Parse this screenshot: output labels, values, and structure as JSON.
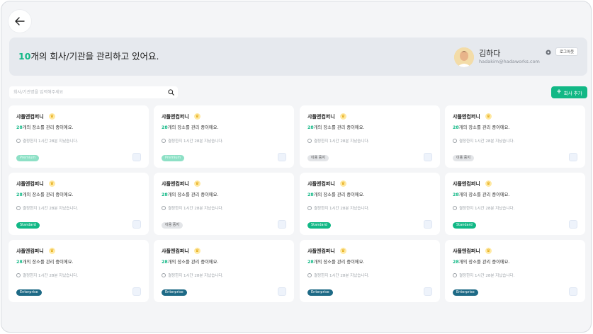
{
  "header": {
    "count": "10",
    "title_rest": "개의 회사/기관을 관리하고 있어요.",
    "user_name": "김하다",
    "user_email": "hadakim@hadaworks.com",
    "logout_label": "로그아웃"
  },
  "search": {
    "placeholder": "회사/기관명을 입력해주세요"
  },
  "add_button_label": "회사 추가",
  "accent_color": "#12b886",
  "cards": [
    {
      "name": "샤플엔컴퍼니",
      "count": "28",
      "desc": "개의 장소를 관리 중이에요.",
      "time": "결정한지 1시간 28분 지났습니다.",
      "badge": "Premium",
      "badge_type": "premium"
    },
    {
      "name": "샤플엔컴퍼니",
      "count": "28",
      "desc": "개의 장소를 관리 중이에요.",
      "time": "결정한지 1시간 28분 지났습니다.",
      "badge": "Premium",
      "badge_type": "premium"
    },
    {
      "name": "샤플엔컴퍼니",
      "count": "28",
      "desc": "개의 장소를 관리 중이에요.",
      "time": "결정한지 1시간 28분 지났습니다.",
      "badge": "이용 중지",
      "badge_type": "notused"
    },
    {
      "name": "샤플엔컴퍼니",
      "count": "28",
      "desc": "개의 장소를 관리 중이에요.",
      "time": "결정한지 1시간 28분 지났습니다.",
      "badge": "이용 중지",
      "badge_type": "notused"
    },
    {
      "name": "샤플엔컴퍼니",
      "count": "28",
      "desc": "개의 장소를 관리 중이에요.",
      "time": "결정한지 1시간 28분 지났습니다.",
      "badge": "Standard",
      "badge_type": "standard"
    },
    {
      "name": "샤플엔컴퍼니",
      "count": "28",
      "desc": "개의 장소를 관리 중이에요.",
      "time": "결정한지 1시간 28분 지났습니다.",
      "badge": "이용 중지",
      "badge_type": "notused"
    },
    {
      "name": "샤플엔컴퍼니",
      "count": "28",
      "desc": "개의 장소를 관리 중이에요.",
      "time": "결정한지 1시간 28분 지났습니다.",
      "badge": "Standard",
      "badge_type": "standard"
    },
    {
      "name": "샤플엔컴퍼니",
      "count": "28",
      "desc": "개의 장소를 관리 중이에요.",
      "time": "결정한지 1시간 28분 지났습니다.",
      "badge": "Standard",
      "badge_type": "standard"
    },
    {
      "name": "샤플엔컴퍼니",
      "count": "28",
      "desc": "개의 장소를 관리 중이에요.",
      "time": "결정한지 1시간 28분 지났습니다.",
      "badge": "Enterprise",
      "badge_type": "enterprise"
    },
    {
      "name": "샤플엔컴퍼니",
      "count": "28",
      "desc": "개의 장소를 관리 중이에요.",
      "time": "결정한지 1시간 28분 지났습니다.",
      "badge": "Enterprise",
      "badge_type": "enterprise"
    },
    {
      "name": "샤플엔컴퍼니",
      "count": "28",
      "desc": "개의 장소를 관리 중이에요.",
      "time": "결정한지 1시간 28분 지났습니다.",
      "badge": "Enterprise",
      "badge_type": "enterprise"
    },
    {
      "name": "샤플엔컴퍼니",
      "count": "28",
      "desc": "개의 장소를 관리 중이에요.",
      "time": "결정한지 1시간 28분 지났습니다.",
      "badge": "Enterprise",
      "badge_type": "enterprise"
    }
  ]
}
